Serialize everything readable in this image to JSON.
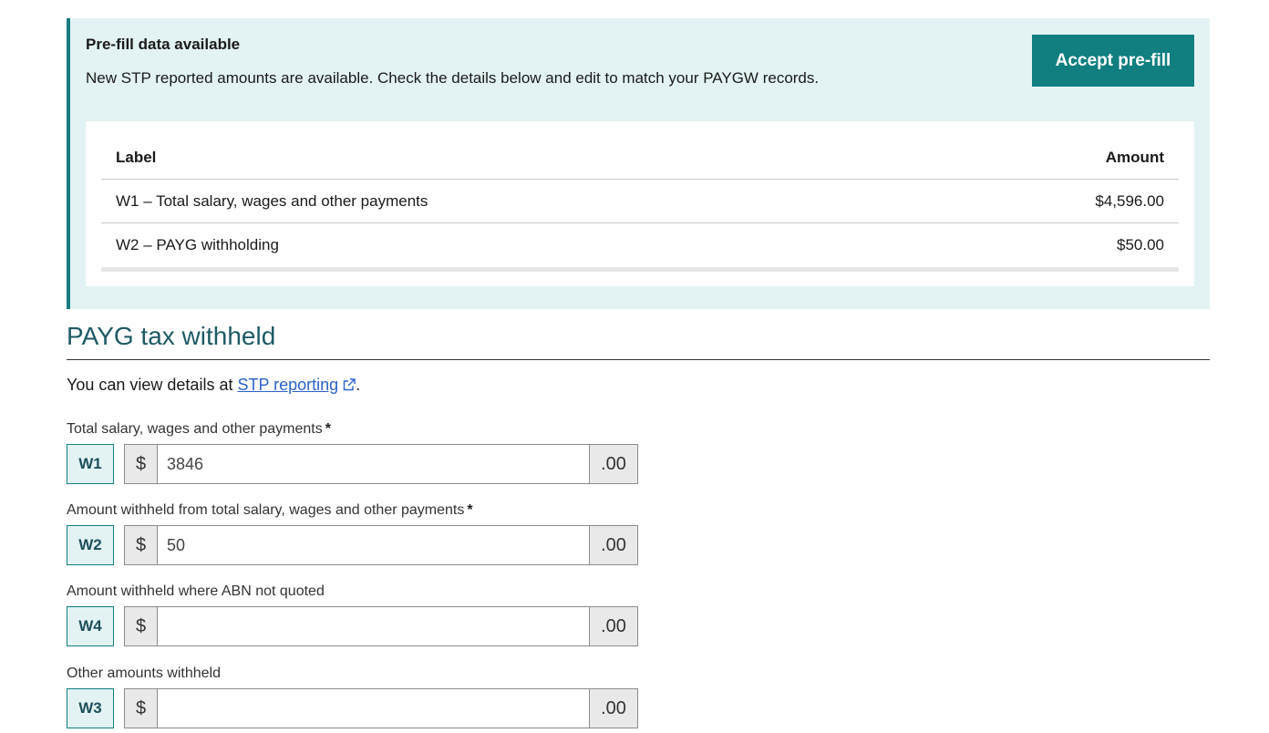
{
  "prefill": {
    "title": "Pre-fill data available",
    "description": "New STP reported amounts are available. Check the details below and edit to match your PAYGW records.",
    "accept_label": "Accept pre-fill",
    "table": {
      "headers": [
        "Label",
        "Amount"
      ],
      "rows": [
        {
          "label": "W1 – Total salary, wages and other payments",
          "amount": "$4,596.00"
        },
        {
          "label": "W2 – PAYG withholding",
          "amount": "$50.00"
        }
      ]
    }
  },
  "section": {
    "title": "PAYG tax withheld",
    "intro_prefix": "You can view details at ",
    "intro_link": "STP reporting",
    "intro_suffix": "."
  },
  "fields": [
    {
      "label": "Total salary, wages and other payments",
      "required": "*",
      "code": "W1",
      "currency": "$",
      "value": "3846",
      "cents": ".00"
    },
    {
      "label": "Amount withheld from total salary, wages and other payments",
      "required": "*",
      "code": "W2",
      "currency": "$",
      "value": "50",
      "cents": ".00"
    },
    {
      "label": "Amount withheld where ABN not quoted",
      "required": "",
      "code": "W4",
      "currency": "$",
      "value": "",
      "cents": ".00"
    },
    {
      "label": "Other amounts withheld",
      "required": "",
      "code": "W3",
      "currency": "$",
      "value": "",
      "cents": ".00"
    }
  ],
  "colors": {
    "accent": "#117e80",
    "panel_bg": "#e3f3f4",
    "heading": "#1d5a64",
    "link": "#2b63c9"
  },
  "icons": {
    "external_link": "external-link-icon"
  }
}
